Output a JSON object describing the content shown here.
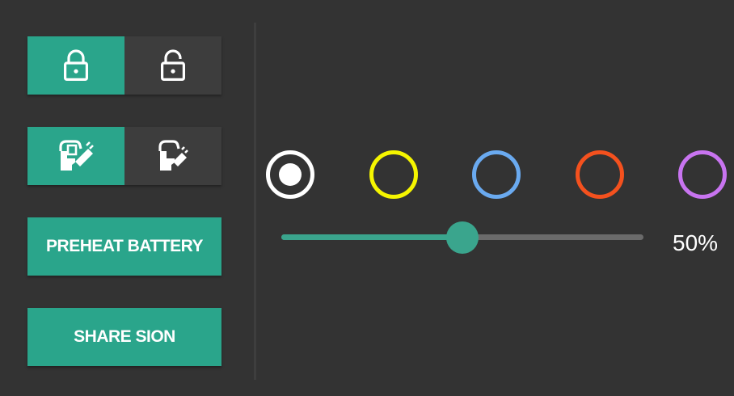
{
  "lock_toggle": {
    "selected": "locked",
    "options": [
      {
        "id": "locked",
        "icon": "lock-closed-icon",
        "active": true
      },
      {
        "id": "unlocked",
        "icon": "lock-open-icon",
        "active": false
      }
    ]
  },
  "charge_port_toggle": {
    "selected": "open",
    "options": [
      {
        "id": "open",
        "icon": "charge-port-open-icon",
        "active": true
      },
      {
        "id": "closed",
        "icon": "charge-port-closed-icon",
        "active": false
      }
    ]
  },
  "actions": {
    "preheat_label": "PREHEAT BATTERY",
    "share_label": "SHARE SION"
  },
  "light_colors": {
    "selected": "white",
    "options": [
      {
        "name": "white",
        "color": "#ffffff"
      },
      {
        "name": "yellow",
        "color": "#f5f500"
      },
      {
        "name": "blue",
        "color": "#6aaaf0"
      },
      {
        "name": "orange",
        "color": "#f4511e"
      },
      {
        "name": "purple",
        "color": "#c874f0"
      }
    ]
  },
  "brightness": {
    "value": 50,
    "display": "50%"
  },
  "colors": {
    "background": "#333333",
    "accent": "#2aa58b",
    "inactive_segment": "#3d3d3d",
    "track": "#6b6b6b"
  }
}
